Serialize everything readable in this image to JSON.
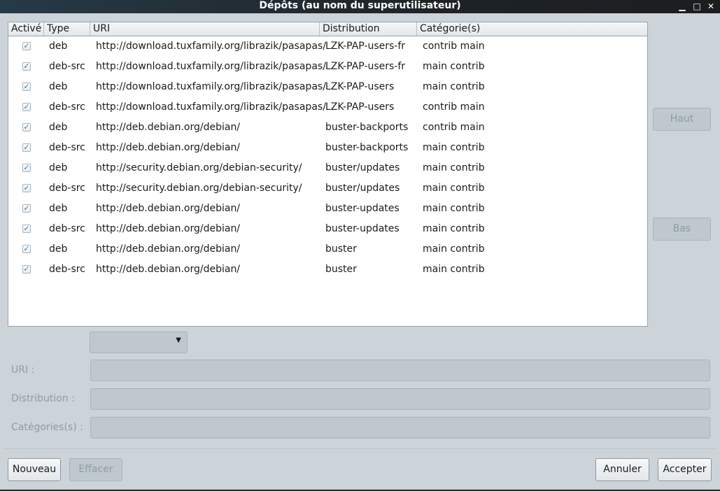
{
  "window": {
    "title": "Dépôts (au nom du superutilisateur)"
  },
  "table": {
    "columns": [
      "Activé",
      "Type",
      "URI",
      "Distribution",
      "Catégorie(s)"
    ],
    "rows": [
      {
        "type": "deb",
        "uri": "http://download.tuxfamily.org/librazik/pasapas/",
        "dist": "LZK-PAP-users-fr",
        "cat": "contrib main"
      },
      {
        "type": "deb-src",
        "uri": "http://download.tuxfamily.org/librazik/pasapas/",
        "dist": "LZK-PAP-users-fr",
        "cat": "main contrib"
      },
      {
        "type": "deb",
        "uri": "http://download.tuxfamily.org/librazik/pasapas/",
        "dist": "LZK-PAP-users",
        "cat": "main contrib"
      },
      {
        "type": "deb-src",
        "uri": "http://download.tuxfamily.org/librazik/pasapas/",
        "dist": "LZK-PAP-users",
        "cat": "contrib main"
      },
      {
        "type": "deb",
        "uri": "http://deb.debian.org/debian/",
        "dist": "buster-backports",
        "cat": "contrib main"
      },
      {
        "type": "deb-src",
        "uri": "http://deb.debian.org/debian/",
        "dist": "buster-backports",
        "cat": "main contrib"
      },
      {
        "type": "deb",
        "uri": "http://security.debian.org/debian-security/",
        "dist": "buster/updates",
        "cat": "main contrib"
      },
      {
        "type": "deb-src",
        "uri": "http://security.debian.org/debian-security/",
        "dist": "buster/updates",
        "cat": "main contrib"
      },
      {
        "type": "deb",
        "uri": "http://deb.debian.org/debian/",
        "dist": "buster-updates",
        "cat": "main contrib"
      },
      {
        "type": "deb-src",
        "uri": "http://deb.debian.org/debian/",
        "dist": "buster-updates",
        "cat": "main contrib"
      },
      {
        "type": "deb",
        "uri": "http://deb.debian.org/debian/",
        "dist": "buster",
        "cat": "main contrib"
      },
      {
        "type": "deb-src",
        "uri": "http://deb.debian.org/debian/",
        "dist": "buster",
        "cat": "main contrib"
      }
    ]
  },
  "side": {
    "up": "Haut",
    "down": "Bas"
  },
  "form": {
    "uri_label": "URI :",
    "dist_label": "Distribution :",
    "cat_label": "Catégories(s) :"
  },
  "buttons": {
    "new": "Nouveau",
    "delete": "Effacer",
    "cancel": "Annuler",
    "accept": "Accepter"
  }
}
